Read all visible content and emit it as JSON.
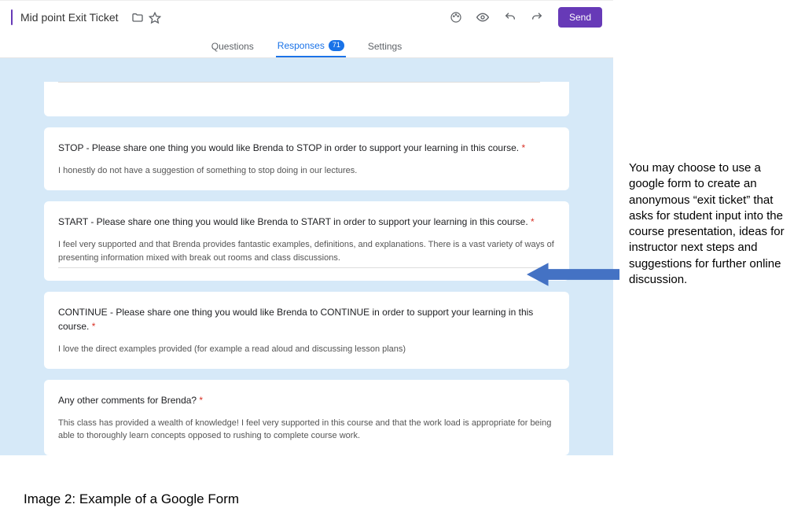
{
  "header": {
    "title": "Mid point Exit Ticket",
    "send_label": "Send"
  },
  "tabs": {
    "questions": "Questions",
    "responses": "Responses",
    "responses_count": "71",
    "settings": "Settings"
  },
  "cards": {
    "stop": {
      "title": "STOP - Please share one thing you would like Brenda to STOP in order to support your learning in this course.",
      "answer": "I honestly do not have a suggestion of something to stop doing in our lectures."
    },
    "start": {
      "title": "START - Please share one thing you would like Brenda to START in order to support your learning in this course.",
      "answer": "I feel very supported and that Brenda provides fantastic examples, definitions, and explanations. There is a vast variety of ways of presenting information mixed with break out rooms and class discussions."
    },
    "continue": {
      "title": "CONTINUE - Please share one thing you would like Brenda to CONTINUE in order to support your learning in this course.",
      "answer": "I love the direct examples provided (for example a read aloud and discussing lesson plans)"
    },
    "other": {
      "title": "Any other comments for Brenda?",
      "answer": "This class has provided a wealth of knowledge! I feel very supported in this course and that the work load is appropriate for being able to thoroughly learn concepts opposed to rushing to complete course work."
    }
  },
  "required_marker": " *",
  "annotation": "You may choose to use a google form to create an anonymous “exit ticket” that asks for student input into the course presentation, ideas for instructor next steps and suggestions for further online discussion.",
  "caption": "Image 2: Example of a Google Form"
}
